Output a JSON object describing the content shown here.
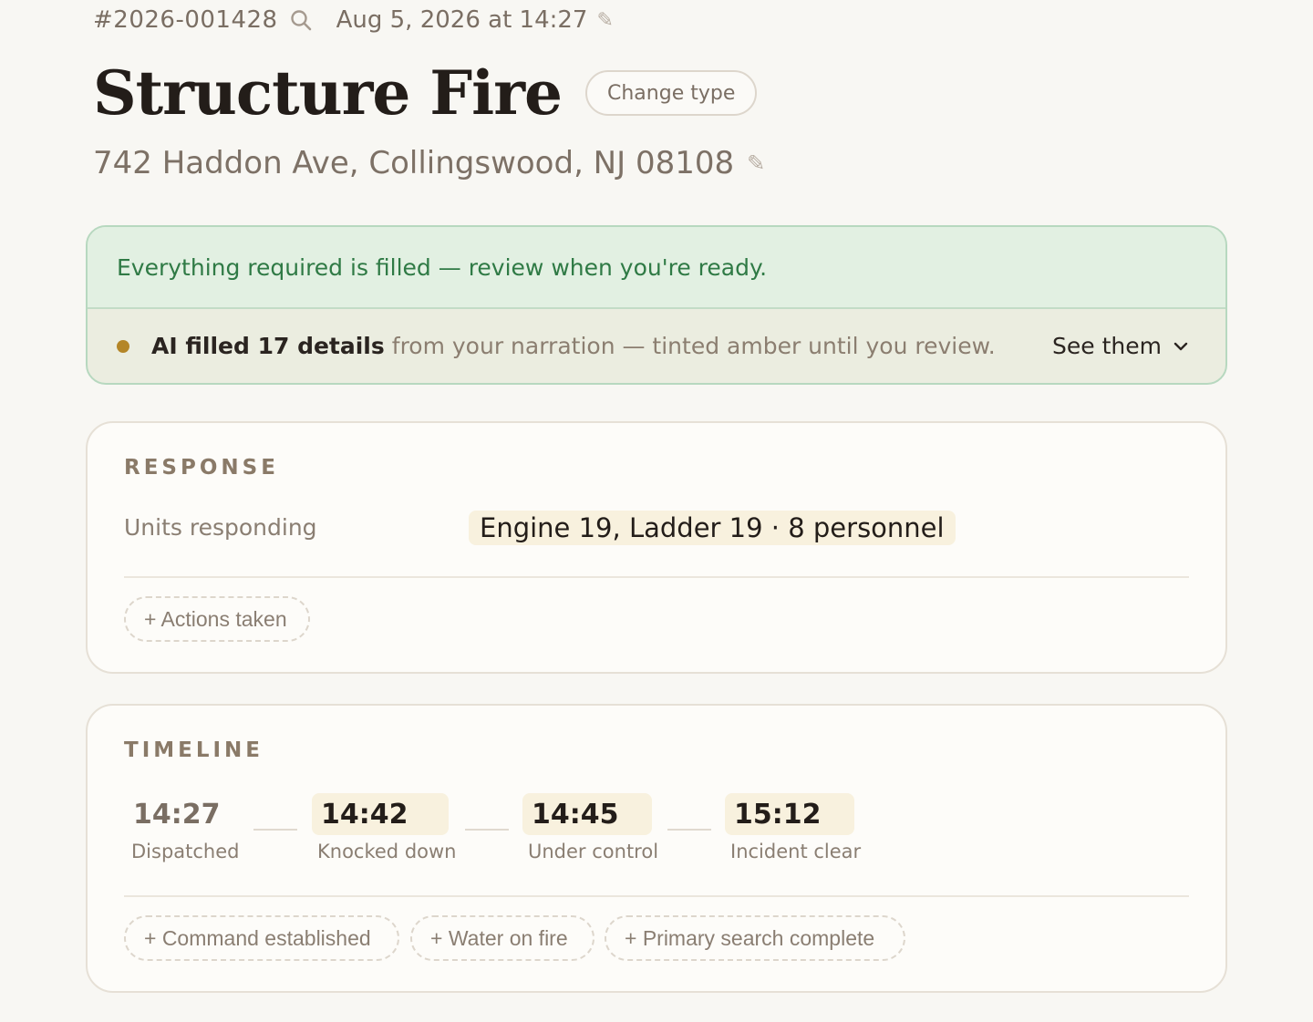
{
  "header": {
    "incident_id": "#2026-001428",
    "datetime": "Aug 5, 2026 at 14:27",
    "title": "Structure Fire",
    "change_type_label": "Change type",
    "address": "742 Haddon Ave, Collingswood, NJ 08108"
  },
  "status": {
    "ready_message": "Everything required is filled — review when you're ready.",
    "ai_strong": "AI filled 17 details",
    "ai_rest": "from your narration — tinted amber until you review.",
    "see_them_label": "See them",
    "colors": {
      "success": "#2f7a45",
      "amber": "#b48628"
    }
  },
  "response": {
    "section_title": "RESPONSE",
    "units_label": "Units responding",
    "units_value": "Engine 19, Ladder 19 · 8 personnel",
    "add_actions_label": "+ Actions taken"
  },
  "timeline": {
    "section_title": "TIMELINE",
    "events": [
      {
        "time": "14:27",
        "label": "Dispatched",
        "ai_filled": false
      },
      {
        "time": "14:42",
        "label": "Knocked down",
        "ai_filled": true
      },
      {
        "time": "14:45",
        "label": "Under control",
        "ai_filled": true
      },
      {
        "time": "15:12",
        "label": "Incident clear",
        "ai_filled": true
      }
    ],
    "add_chips": [
      "+ Command established",
      "+ Water on fire",
      "+ Primary search complete"
    ]
  },
  "icons": {
    "search": "search-icon",
    "edit": "pencil-icon",
    "status_dot": "amber-dot-icon",
    "expand": "chevron-down-icon"
  }
}
